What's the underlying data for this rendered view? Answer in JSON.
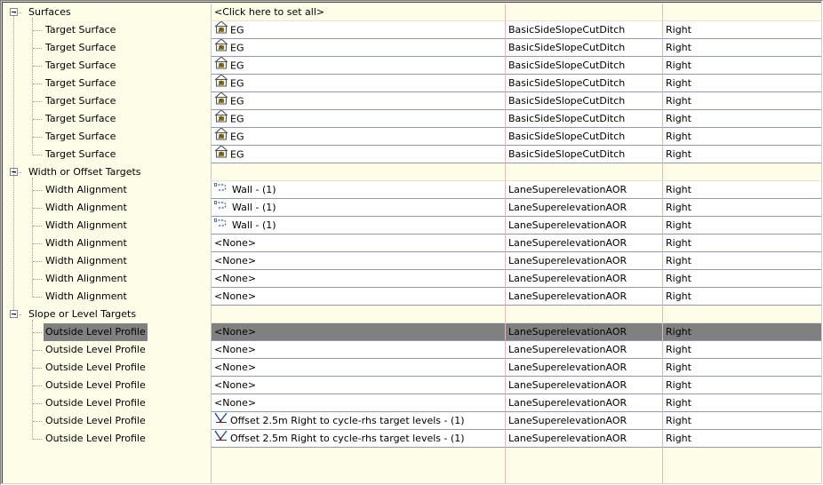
{
  "groups": [
    {
      "label": "Surfaces",
      "value": "<Click here to set all>",
      "rows": [
        {
          "label": "Target Surface",
          "value": "EG",
          "icon": "surface-icon",
          "subassembly": "BasicSideSlopeCutDitch",
          "side": "Right"
        },
        {
          "label": "Target Surface",
          "value": "EG",
          "icon": "surface-icon",
          "subassembly": "BasicSideSlopeCutDitch",
          "side": "Right"
        },
        {
          "label": "Target Surface",
          "value": "EG",
          "icon": "surface-icon",
          "subassembly": "BasicSideSlopeCutDitch",
          "side": "Right"
        },
        {
          "label": "Target Surface",
          "value": "EG",
          "icon": "surface-icon",
          "subassembly": "BasicSideSlopeCutDitch",
          "side": "Right"
        },
        {
          "label": "Target Surface",
          "value": "EG",
          "icon": "surface-icon",
          "subassembly": "BasicSideSlopeCutDitch",
          "side": "Right"
        },
        {
          "label": "Target Surface",
          "value": "EG",
          "icon": "surface-icon",
          "subassembly": "BasicSideSlopeCutDitch",
          "side": "Right"
        },
        {
          "label": "Target Surface",
          "value": "EG",
          "icon": "surface-icon",
          "subassembly": "BasicSideSlopeCutDitch",
          "side": "Right"
        },
        {
          "label": "Target Surface",
          "value": "EG",
          "icon": "surface-icon",
          "subassembly": "BasicSideSlopeCutDitch",
          "side": "Right"
        }
      ]
    },
    {
      "label": "Width or Offset Targets",
      "value": "",
      "rows": [
        {
          "label": "Width Alignment",
          "value": "Wall - (1)",
          "icon": "alignment-icon",
          "subassembly": "LaneSuperelevationAOR",
          "side": "Right"
        },
        {
          "label": "Width Alignment",
          "value": "Wall - (1)",
          "icon": "alignment-icon",
          "subassembly": "LaneSuperelevationAOR",
          "side": "Right"
        },
        {
          "label": "Width Alignment",
          "value": "Wall - (1)",
          "icon": "alignment-icon",
          "subassembly": "LaneSuperelevationAOR",
          "side": "Right"
        },
        {
          "label": "Width Alignment",
          "value": "<None>",
          "icon": "",
          "subassembly": "LaneSuperelevationAOR",
          "side": "Right"
        },
        {
          "label": "Width Alignment",
          "value": "<None>",
          "icon": "",
          "subassembly": "LaneSuperelevationAOR",
          "side": "Right"
        },
        {
          "label": "Width Alignment",
          "value": "<None>",
          "icon": "",
          "subassembly": "LaneSuperelevationAOR",
          "side": "Right"
        },
        {
          "label": "Width Alignment",
          "value": "<None>",
          "icon": "",
          "subassembly": "LaneSuperelevationAOR",
          "side": "Right"
        }
      ]
    },
    {
      "label": "Slope or Level Targets",
      "value": "",
      "rows": [
        {
          "label": "Outside Level Profile",
          "value": "<None>",
          "icon": "",
          "subassembly": "LaneSuperelevationAOR",
          "side": "Right",
          "selected": true
        },
        {
          "label": "Outside Level Profile",
          "value": "<None>",
          "icon": "",
          "subassembly": "LaneSuperelevationAOR",
          "side": "Right"
        },
        {
          "label": "Outside Level Profile",
          "value": "<None>",
          "icon": "",
          "subassembly": "LaneSuperelevationAOR",
          "side": "Right"
        },
        {
          "label": "Outside Level Profile",
          "value": "<None>",
          "icon": "",
          "subassembly": "LaneSuperelevationAOR",
          "side": "Right"
        },
        {
          "label": "Outside Level Profile",
          "value": "<None>",
          "icon": "",
          "subassembly": "LaneSuperelevationAOR",
          "side": "Right"
        },
        {
          "label": "Outside Level Profile",
          "value": "Offset 2.5m Right to cycle-rhs target levels - (1)",
          "icon": "profile-icon",
          "subassembly": "LaneSuperelevationAOR",
          "side": "Right"
        },
        {
          "label": "Outside Level Profile",
          "value": "Offset 2.5m Right to cycle-rhs target levels - (1)",
          "icon": "profile-icon",
          "subassembly": "LaneSuperelevationAOR",
          "side": "Right"
        }
      ]
    }
  ],
  "colors": {
    "tree_background": "#fefee8",
    "grid_line": "#8f9ab7",
    "selected_row": "#808080"
  }
}
